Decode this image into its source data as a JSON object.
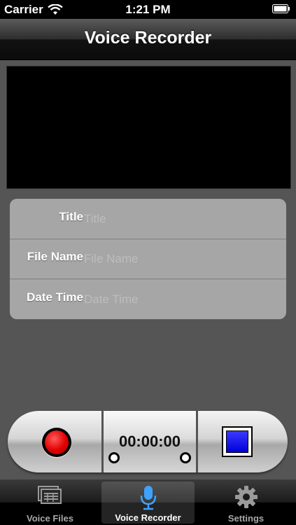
{
  "status_bar": {
    "carrier": "Carrier",
    "time": "1:21 PM",
    "icons": [
      "wifi-icon",
      "battery-icon"
    ]
  },
  "nav": {
    "title": "Voice Recorder"
  },
  "form": {
    "rows": [
      {
        "label": "Title",
        "placeholder": "Title",
        "value": ""
      },
      {
        "label": "File Name",
        "placeholder": "File Name",
        "value": ""
      },
      {
        "label": "Date Time",
        "placeholder": "Date Time",
        "value": ""
      }
    ]
  },
  "controls": {
    "record_icon": "record-icon",
    "timer": "00:00:00",
    "stop_icon": "stop-icon",
    "colors": {
      "record": "#e00000",
      "stop": "#0000d8"
    }
  },
  "tabs": [
    {
      "label": "Voice Files",
      "icon": "voice-files-icon",
      "selected": false
    },
    {
      "label": "Voice Recorder",
      "icon": "microphone-icon",
      "selected": true
    },
    {
      "label": "Settings",
      "icon": "gear-icon",
      "selected": false
    }
  ]
}
